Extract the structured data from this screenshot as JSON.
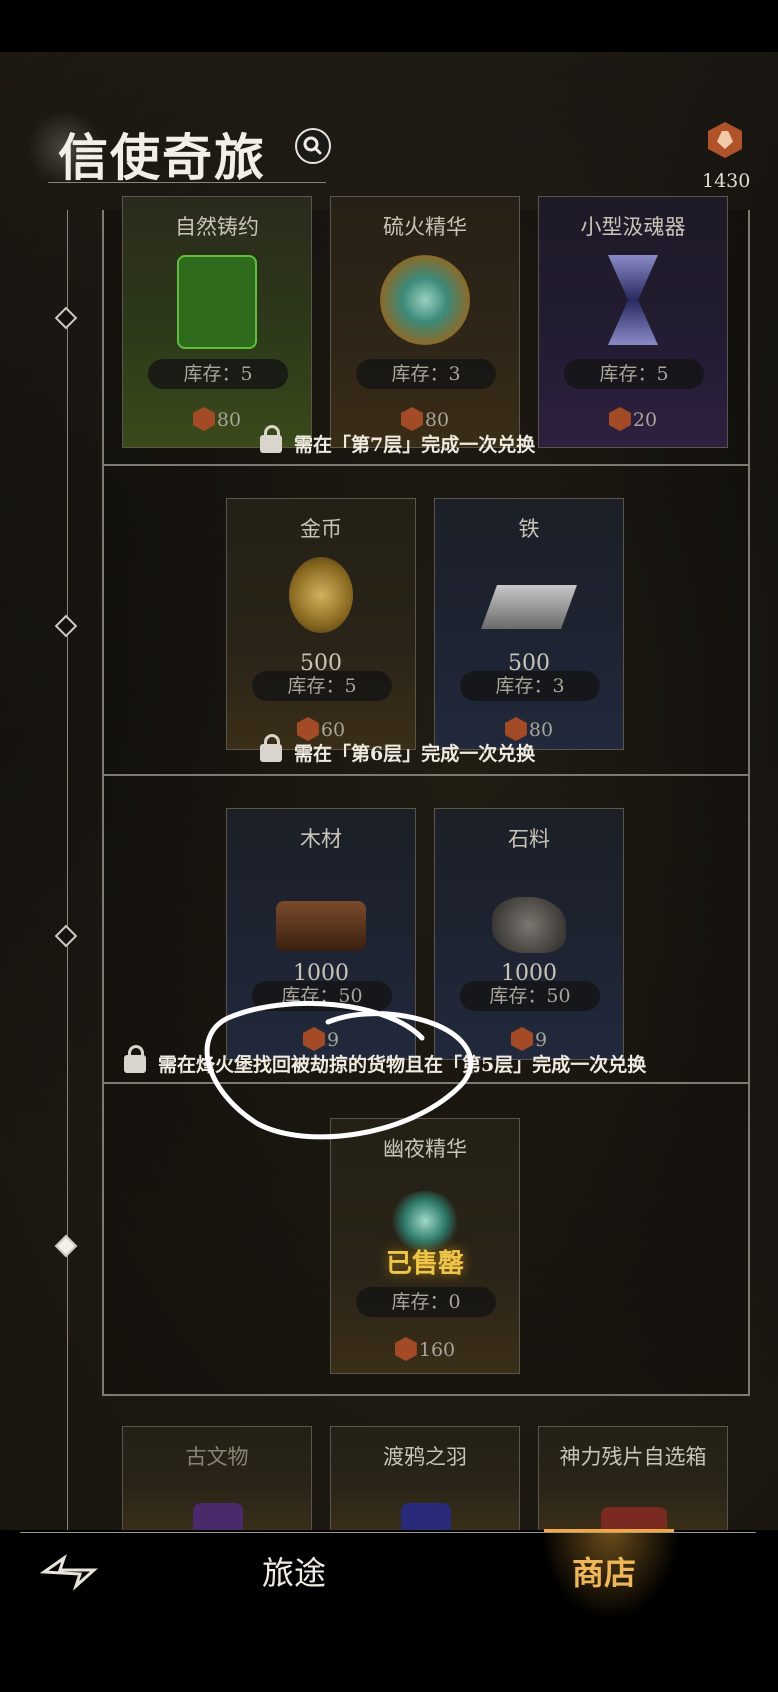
{
  "header": {
    "title": "信使奇旅",
    "currency_value": "1430"
  },
  "tiers": [
    {
      "items": [
        {
          "name": "自然铸约",
          "stock": "库存：5",
          "price": "80"
        },
        {
          "name": "硫火精华",
          "stock": "库存：3",
          "price": "80"
        },
        {
          "name": "小型汲魂器",
          "stock": "库存：5",
          "price": "20"
        }
      ],
      "lock_text": "需在「第7层」完成一次兑换"
    },
    {
      "items": [
        {
          "name": "金币",
          "count": "500",
          "stock": "库存：5",
          "price": "60"
        },
        {
          "name": "铁",
          "count": "500",
          "stock": "库存：3",
          "price": "80"
        }
      ],
      "lock_text": "需在「第6层」完成一次兑换"
    },
    {
      "items": [
        {
          "name": "木材",
          "count": "1000",
          "stock": "库存：50",
          "price": "9"
        },
        {
          "name": "石料",
          "count": "1000",
          "stock": "库存：50",
          "price": "9"
        }
      ],
      "lock_text": "需在烽火堡找回被劫掠的货物且在「第5层」完成一次兑换"
    },
    {
      "items": [
        {
          "name": "幽夜精华",
          "status": "已售罄",
          "stock": "库存：0",
          "price": "160"
        }
      ]
    },
    {
      "items": [
        {
          "name": "古文物"
        },
        {
          "name": "渡鸦之羽"
        },
        {
          "name": "神力残片自选箱"
        }
      ]
    }
  ],
  "bottom_nav": {
    "journey": "旅途",
    "shop": "商店"
  },
  "colors": {
    "accent_gold": "#f0b75a",
    "soldout_gold": "#f0c64a",
    "currency_red": "#b0532a"
  },
  "icons": [
    "search-icon",
    "currency-icon",
    "lock-icon",
    "home-icon"
  ]
}
